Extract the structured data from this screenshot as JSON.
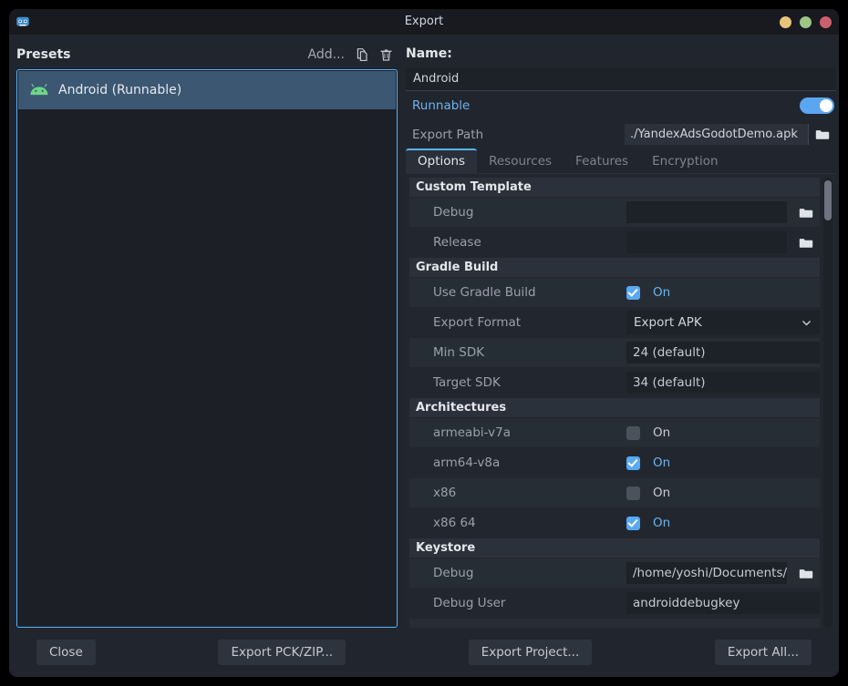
{
  "window": {
    "title": "Export",
    "app_icon": "godot-logo-icon",
    "controls": [
      {
        "name": "minimize-button",
        "color": "#e8c47a"
      },
      {
        "name": "maximize-button",
        "color": "#9dc585"
      },
      {
        "name": "close-button",
        "color": "#cc5f6e"
      }
    ]
  },
  "presets": {
    "title": "Presets",
    "add_label": "Add...",
    "duplicate_icon": "duplicate-icon",
    "delete_icon": "trash-icon",
    "items": [
      {
        "label": "Android (Runnable)",
        "icon": "android-robot-icon",
        "selected": true
      }
    ]
  },
  "details": {
    "name_label": "Name:",
    "name_value": "Android",
    "runnable_label": "Runnable",
    "runnable_on": true,
    "export_path_label": "Export Path",
    "export_path_value": "./YandexAdsGodotDemo.apk",
    "export_path_browse_icon": "folder-icon"
  },
  "tabs": [
    {
      "label": "Options",
      "active": true
    },
    {
      "label": "Resources",
      "active": false
    },
    {
      "label": "Features",
      "active": false
    },
    {
      "label": "Encryption",
      "active": false
    }
  ],
  "options": {
    "sections": [
      {
        "title": "Custom Template",
        "rows": [
          {
            "label": "Debug",
            "type": "path",
            "value": "",
            "browse_icon": "folder-icon"
          },
          {
            "label": "Release",
            "type": "path",
            "value": "",
            "browse_icon": "folder-icon"
          }
        ]
      },
      {
        "title": "Gradle Build",
        "rows": [
          {
            "label": "Use Gradle Build",
            "type": "checkbox",
            "checked": true,
            "state_text": "On"
          },
          {
            "label": "Export Format",
            "type": "select",
            "value": "Export APK",
            "chevron_icon": "chevron-down-icon"
          },
          {
            "label": "Min SDK",
            "type": "text",
            "value": "24 (default)"
          },
          {
            "label": "Target SDK",
            "type": "text",
            "value": "34 (default)"
          }
        ]
      },
      {
        "title": "Architectures",
        "rows": [
          {
            "label": "armeabi-v7a",
            "type": "checkbox",
            "checked": false,
            "state_text": "On"
          },
          {
            "label": "arm64-v8a",
            "type": "checkbox",
            "checked": true,
            "state_text": "On"
          },
          {
            "label": "x86",
            "type": "checkbox",
            "checked": false,
            "state_text": "On"
          },
          {
            "label": "x86 64",
            "type": "checkbox",
            "checked": true,
            "state_text": "On"
          }
        ]
      },
      {
        "title": "Keystore",
        "rows": [
          {
            "label": "Debug",
            "type": "path",
            "value": "/home/yoshi/Documents/",
            "browse_icon": "folder-icon"
          },
          {
            "label": "Debug User",
            "type": "text",
            "value": "androiddebugkey"
          }
        ]
      }
    ]
  },
  "footer": {
    "close_label": "Close",
    "export_pck_label": "Export PCK/ZIP...",
    "export_project_label": "Export Project...",
    "export_all_label": "Export All..."
  }
}
